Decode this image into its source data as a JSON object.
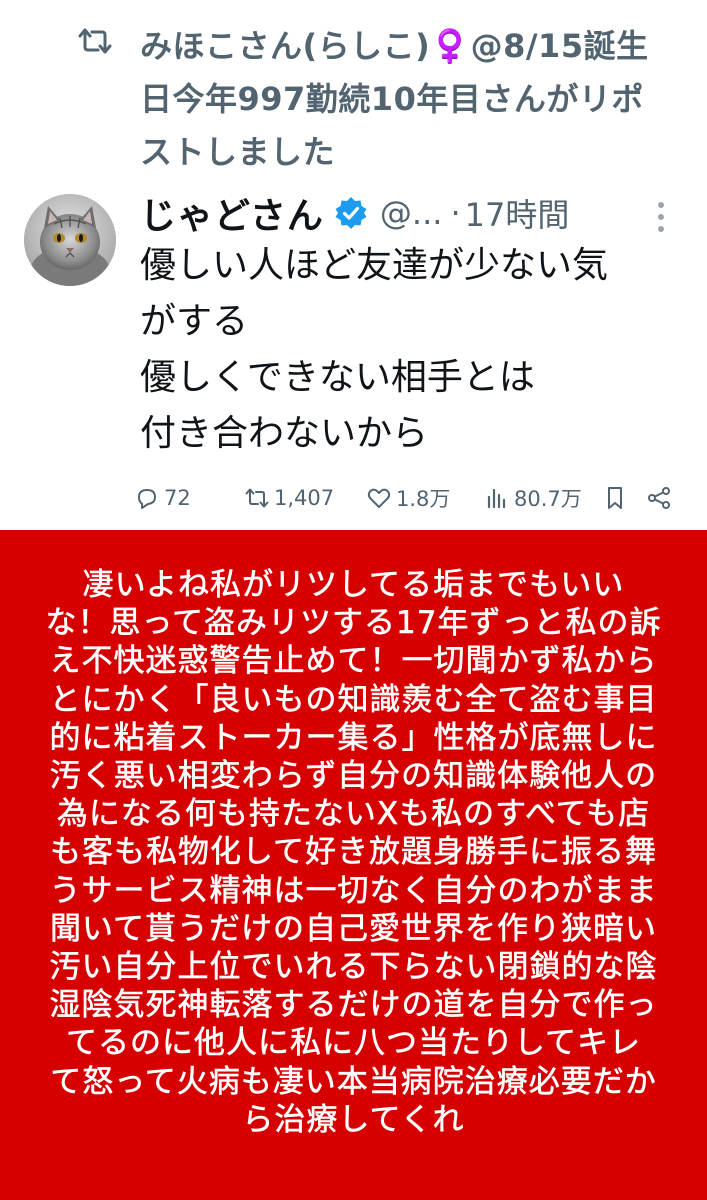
{
  "repost": {
    "text_lines": [
      "みほこさん(らしこ)♀️@8/15誕生",
      "日今年997勤続10年目さんがリポ",
      "ストしました"
    ]
  },
  "tweet": {
    "author_name": "じゃどさん",
    "handle": "@...",
    "separator": "·",
    "time": "17時間",
    "body_lines": [
      "優しい人ほど友達が少ない気",
      "がする",
      "優しくできない相手とは",
      "付き合わないから"
    ],
    "colors": {
      "verified": "#1d9bf0",
      "text": "#0f1419",
      "secondary": "#536471"
    }
  },
  "actions": {
    "replies": "72",
    "reposts": "1,407",
    "likes": "1.8万",
    "views": "80.7万",
    "icons": [
      "reply-icon",
      "repost-icon",
      "like-icon",
      "views-icon",
      "bookmark-icon",
      "share-icon"
    ]
  },
  "image_panel": {
    "background": "#d60000",
    "lines": [
      "凄いよね私がリツしてる垢までもいい",
      "な！思って盗みリツする17年ずっと私の訴",
      "え不快迷惑警告止めて！一切聞かず私から",
      "とにかく「良いもの知識羨む全て盗む事目",
      "的に粘着ストーカー集る」性格が底無しに",
      "汚く悪い相変わらず自分の知識体験他人の",
      "為になる何も持たないXも私のすべても店",
      "も客も私物化して好き放題身勝手に振る舞",
      "うサービス精神は一切なく自分のわがまま",
      "聞いて貰うだけの自己愛世界を作り狭暗い",
      "汚い自分上位でいれる下らない閉鎖的な陰",
      "湿陰気死神転落するだけの道を自分で作っ",
      "てるのに他人に私に八つ当たりしてキレ",
      "て怒って火病も凄い本当病院治療必要だか",
      "ら治療してくれ"
    ]
  }
}
